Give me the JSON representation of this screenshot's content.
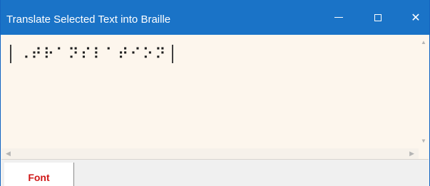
{
  "window": {
    "title": "Translate Selected Text into Braille",
    "controls": {
      "minimize": "—",
      "maximize": "☐",
      "close": "✕"
    }
  },
  "editor": {
    "braille_text": "⠠⠞⠗⠁⠝⠎⠇⠁⠞⠊⠕⠝"
  },
  "scrollbars": {
    "up": "▲",
    "down": "▼",
    "left": "◀",
    "right": "▶"
  },
  "tabs": {
    "font_label": "Font"
  },
  "colors": {
    "titlebar": "#1a73c7",
    "editor_bg": "#fdf6ed",
    "tab_label": "#d01818"
  }
}
